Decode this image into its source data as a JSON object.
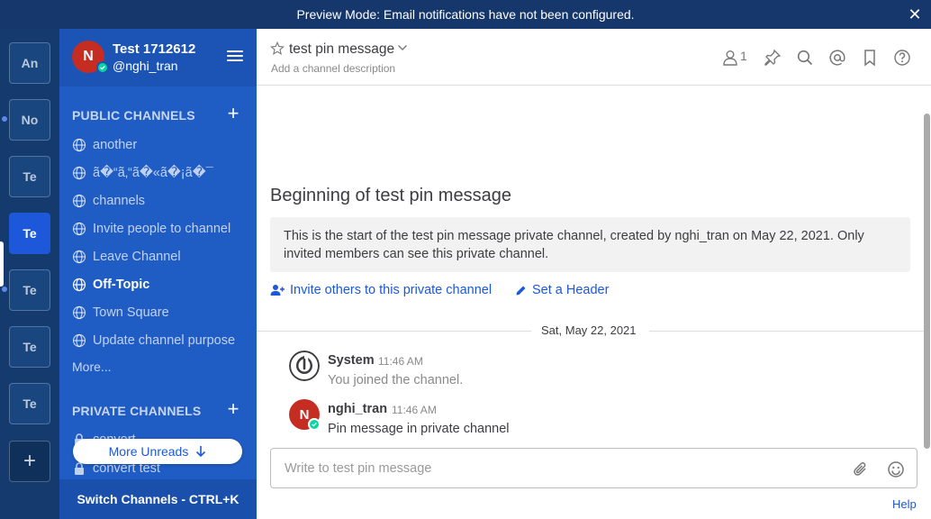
{
  "banner": {
    "text": "Preview Mode: Email notifications have not been configured.",
    "close_label": "✕"
  },
  "teams": {
    "items": [
      {
        "label": "An"
      },
      {
        "label": "No"
      },
      {
        "label": "Te"
      },
      {
        "label": "Te"
      },
      {
        "label": "Te"
      },
      {
        "label": "Te"
      },
      {
        "label": "Te"
      }
    ],
    "add_label": "+"
  },
  "sidebar": {
    "team_name": "Test 1712612",
    "username": "@nghi_tran",
    "avatar_initial": "N",
    "public_title": "PUBLIC CHANNELS",
    "public_channels": [
      {
        "label": "another"
      },
      {
        "label": "ã�“ã‚“ã�«ã�¡ã�¯"
      },
      {
        "label": "channels"
      },
      {
        "label": "Invite people to channel"
      },
      {
        "label": "Leave Channel"
      },
      {
        "label": "Off-Topic"
      },
      {
        "label": "Town Square"
      },
      {
        "label": "Update channel purpose"
      }
    ],
    "more_label": "More...",
    "private_title": "PRIVATE CHANNELS",
    "private_channels": [
      {
        "label": "convert"
      },
      {
        "label": "convert test"
      }
    ],
    "more_unreads_label": "More Unreads",
    "switch_label": "Switch Channels - CTRL+K"
  },
  "channel": {
    "name": "test pin message",
    "description_placeholder": "Add a channel description",
    "member_count": "1",
    "begin_title": "Beginning of test pin message",
    "intro_text": "This is the start of the test pin message private channel, created by nghi_tran on May 22, 2021. Only invited members can see this private channel.",
    "invite_label": "Invite others to this private channel",
    "header_label": "Set a Header",
    "date_separator": "Sat, May 22, 2021"
  },
  "posts": [
    {
      "author": "System",
      "time": "11:46 AM",
      "text": "You joined the channel."
    },
    {
      "author": "nghi_tran",
      "time": "11:46 AM",
      "text": "Pin message in private channel",
      "avatar_initial": "N"
    }
  ],
  "composer": {
    "placeholder": "Write to test pin message"
  },
  "help_label": "Help",
  "colors": {
    "banner": "#15376b",
    "sidebar": "#1f5cc4",
    "team_sidebar": "#143a6e",
    "link": "#1c58d9",
    "avatar": "#c62d22",
    "online": "#06d6a0"
  }
}
